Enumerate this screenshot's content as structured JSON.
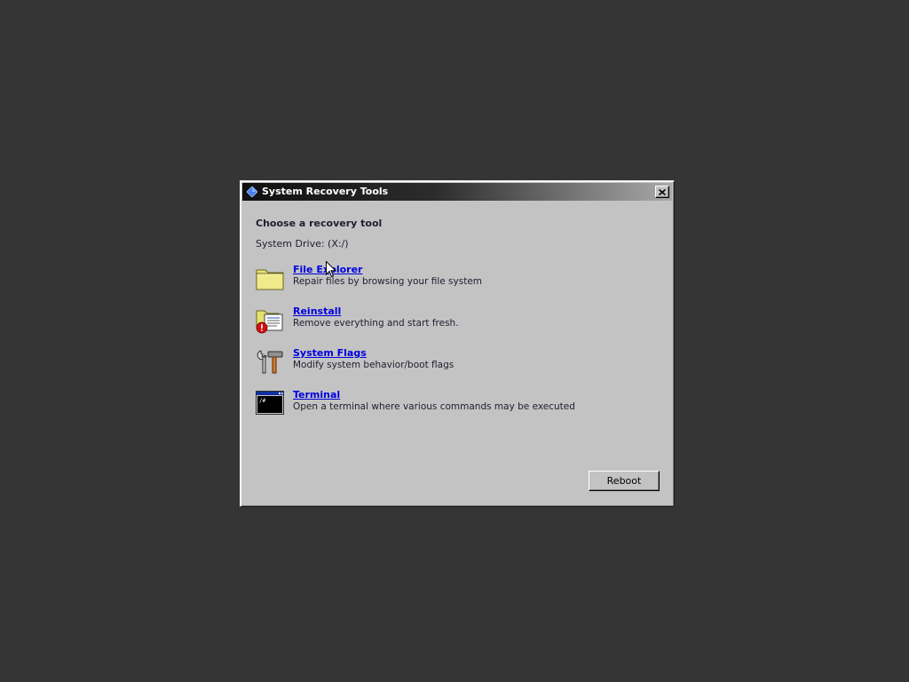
{
  "window": {
    "title": "System Recovery Tools",
    "close_icon": "close-icon"
  },
  "main": {
    "heading": "Choose a recovery tool",
    "drive_label": "System Drive: (X:/)"
  },
  "tools": [
    {
      "title": "File Explorer",
      "description": "Repair files by browsing your file system",
      "icon": "folder-icon"
    },
    {
      "title": "Reinstall",
      "description": "Remove everything and start fresh.",
      "icon": "reinstall-icon"
    },
    {
      "title": "System Flags",
      "description": "Modify system behavior/boot flags",
      "icon": "tools-icon"
    },
    {
      "title": "Terminal",
      "description": "Open a terminal where various commands may be executed",
      "icon": "terminal-icon"
    }
  ],
  "footer": {
    "reboot_label": "Reboot"
  },
  "colors": {
    "desktop": "#353535",
    "window_bg": "#c3c3c3",
    "link": "#0000e0",
    "accent": "#4a7fe8"
  }
}
